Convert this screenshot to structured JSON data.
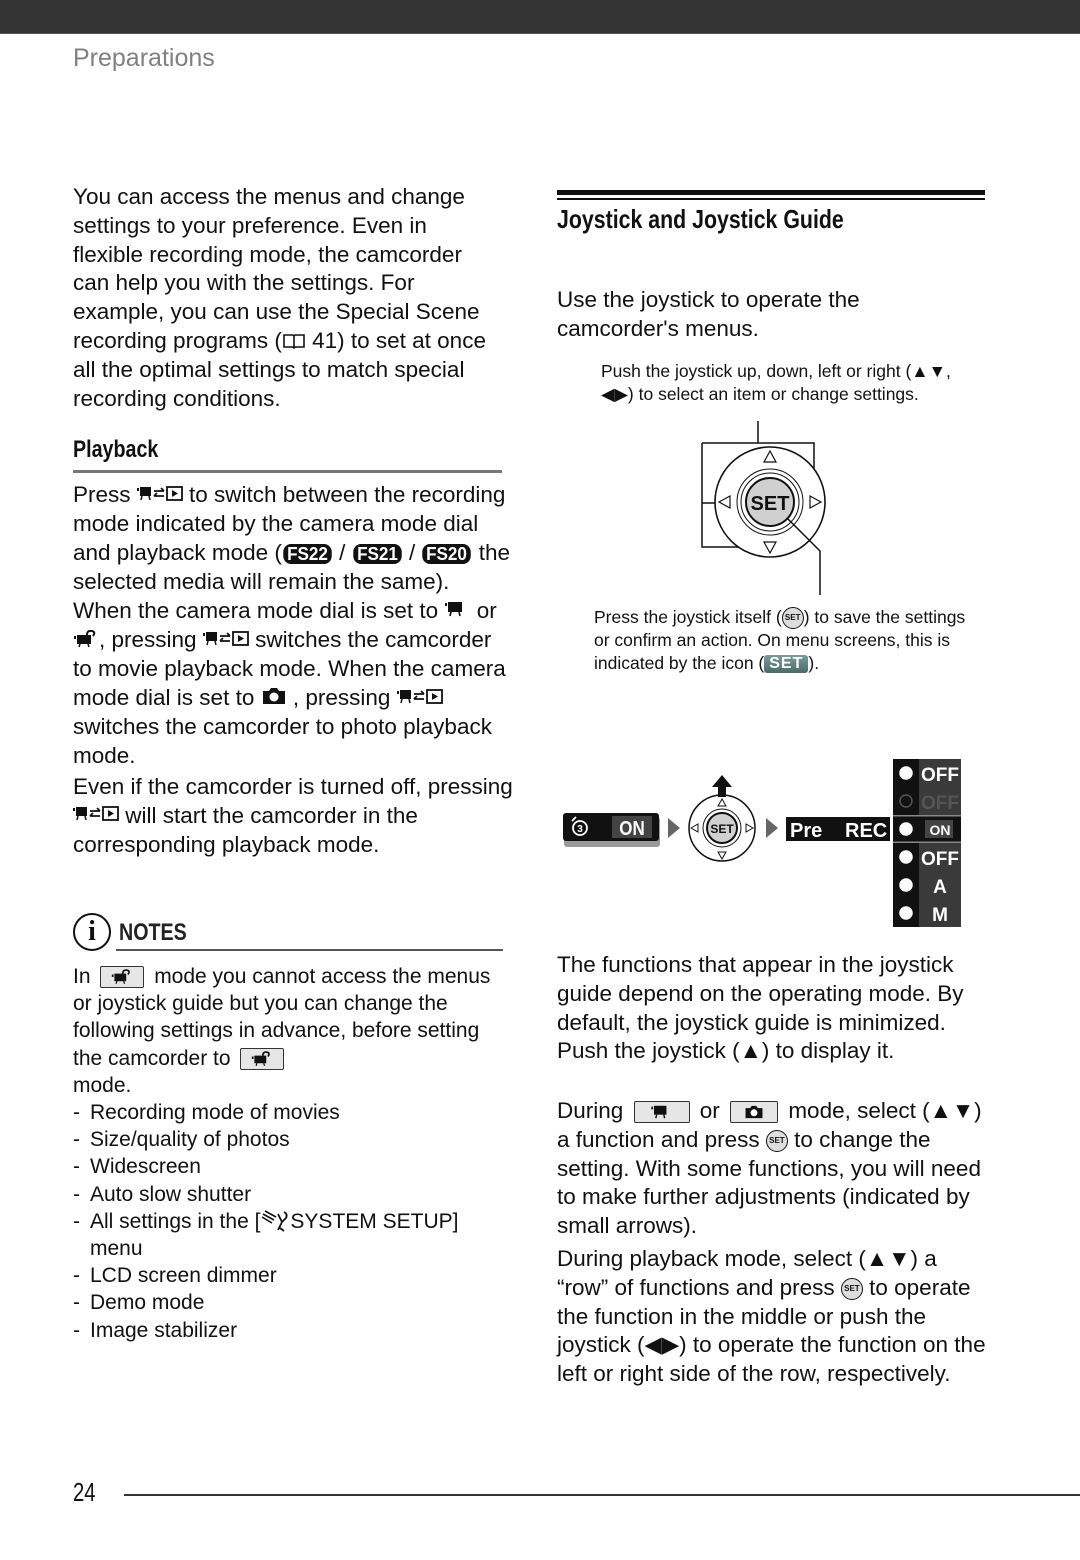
{
  "header": {
    "section": "Preparations"
  },
  "left": {
    "intro": "You can access the menus and change settings to your preference. Even in flexible recording mode, the camcorder can help you with the settings. For example, you can use the Special Scene recording programs (",
    "intro_ref_icon": "book-icon",
    "intro_ref_page": "41",
    "intro_tail": ") to set at once all the optimal settings to match special recording conditions.",
    "playback": {
      "heading": "Playback",
      "p1_a": "Press ",
      "p1_b": " to switch between the recording mode indicated by the camera mode dial and playback mode (",
      "models": [
        "FS22",
        "FS21",
        "FS20"
      ],
      "sep": " / ",
      "p1_c": " the selected media will remain the same). When the camera mode dial is set to ",
      "p1_or": " or ",
      "p1_d": ", pressing ",
      "p1_e": " switches the camcorder to movie playback mode. When the camera mode dial is set to ",
      "p1_f": " , pressing ",
      "p1_g": " switches the camcorder to photo playback mode.",
      "p2_a": "Even if the camcorder is turned off, pressing ",
      "p2_b": " will start the camcorder in the corresponding playback mode."
    },
    "notes": {
      "icon": "info-icon",
      "icon_glyph": "i",
      "label": "NOTES",
      "p_a": "In ",
      "p_b": " mode you cannot access the menus or joystick guide but you can change the following settings in advance, before setting the camcorder to ",
      "p_c": " mode.",
      "items": [
        "Recording mode of movies",
        "Size/quality of photos",
        "Widescreen",
        "Auto slow shutter",
        "All settings in the [",
        "LCD screen dimmer",
        "Demo mode",
        "Image stabilizer"
      ],
      "system_setup": "SYSTEM SETUP]",
      "system_setup_tail": "menu"
    }
  },
  "right": {
    "heading": "Joystick and Joystick Guide",
    "intro": "Use the joystick to operate the camcorder's menus.",
    "callout_top_a": "Push the joystick up, down, left or right (",
    "callout_top_updown": "▲▼",
    "callout_top_comma": ", ",
    "callout_top_leftright": "◀▶",
    "callout_top_b": ") to select an item or change settings.",
    "callout_bottom_a": "Press the joystick itself (",
    "set_small": "SET",
    "callout_bottom_b": ") to save the settings or confirm an action. On menu screens, this is indicated by the icon (",
    "set_key": "SET",
    "callout_bottom_c": ").",
    "joystick_center": "SET",
    "guide": {
      "minimized_value": "ON",
      "prerec_label_1": "Pre",
      "prerec_label_2": "REC",
      "rows": [
        {
          "icon": "effect-icon",
          "value": "OFF",
          "state": "normal"
        },
        {
          "icon": "portrait-icon",
          "value": "OFF",
          "state": "disabled"
        },
        {
          "icon": "prerec-icon",
          "value": "ON",
          "state": "selected"
        },
        {
          "icon": "backlight-icon",
          "value": "OFF",
          "state": "normal"
        },
        {
          "icon": "exposure-icon",
          "value": "A",
          "state": "normal"
        },
        {
          "icon": "focus-icon",
          "value": "M",
          "state": "normal"
        }
      ]
    },
    "p1_a": "The functions that appear in the joystick guide depend on the operating mode. By default, the joystick guide is minimized. Push the joystick (",
    "p1_up": "▲",
    "p1_b": ") to display it.",
    "p2_a": "During ",
    "p2_or": " or ",
    "p2_b": " mode, select (",
    "p2_updown": "▲▼",
    "p2_c": ") a function and press ",
    "p2_d": " to change the setting. With some functions, you will need to make further adjustments (indicated by small arrows).",
    "p3_a": "During playback mode, select (",
    "p3_updown": "▲▼",
    "p3_b": ") a “row” of functions and press ",
    "p3_c": " to operate the function in the middle or push the joystick (",
    "p3_leftright": "◀▶",
    "p3_d": ") to operate the function on the left or right side of the row, respectively."
  },
  "footer": {
    "page_number": "24"
  }
}
